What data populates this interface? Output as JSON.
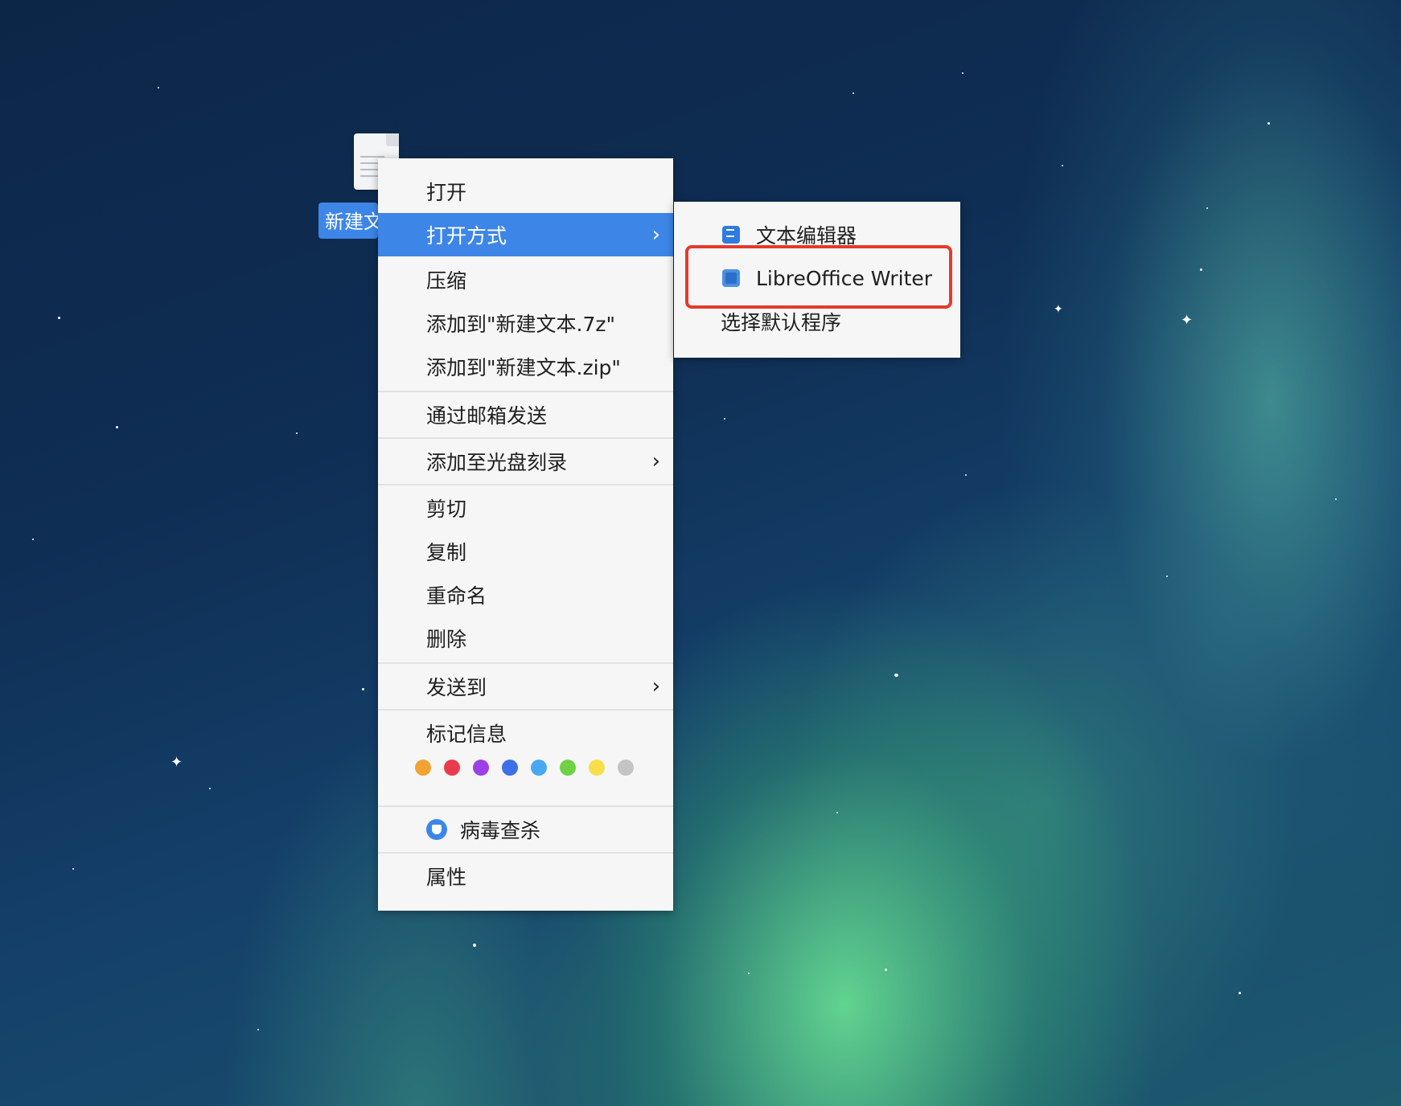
{
  "desktop": {
    "file_label": "新建文本"
  },
  "context_menu": {
    "items": [
      {
        "label": "打开"
      },
      {
        "label": "打开方式",
        "submenu": true,
        "active": true
      },
      {
        "label": "压缩"
      },
      {
        "label": "添加到\"新建文本.7z\""
      },
      {
        "label": "添加到\"新建文本.zip\""
      },
      {
        "label": "通过邮箱发送"
      },
      {
        "label": "添加至光盘刻录",
        "submenu": true
      },
      {
        "label": "剪切"
      },
      {
        "label": "复制"
      },
      {
        "label": "重命名"
      },
      {
        "label": "删除"
      },
      {
        "label": "发送到",
        "submenu": true
      },
      {
        "label": "标记信息"
      },
      {
        "label": "病毒查杀",
        "icon": "shield-icon"
      },
      {
        "label": "属性"
      }
    ],
    "chevron": "›",
    "tag_colors": [
      "#f1a233",
      "#ea3b4d",
      "#9b41e6",
      "#3d6fe6",
      "#48a9f0",
      "#6fd145",
      "#f5e04a",
      "#c4c4c4"
    ]
  },
  "open_with_submenu": {
    "items": [
      {
        "label": "文本编辑器",
        "icon": "text-editor-icon"
      },
      {
        "label": "LibreOffice Writer",
        "icon": "libreoffice-writer-icon",
        "highlighted": true
      },
      {
        "label": "选择默认程序"
      }
    ],
    "highlight_color": "#e53a2b"
  }
}
